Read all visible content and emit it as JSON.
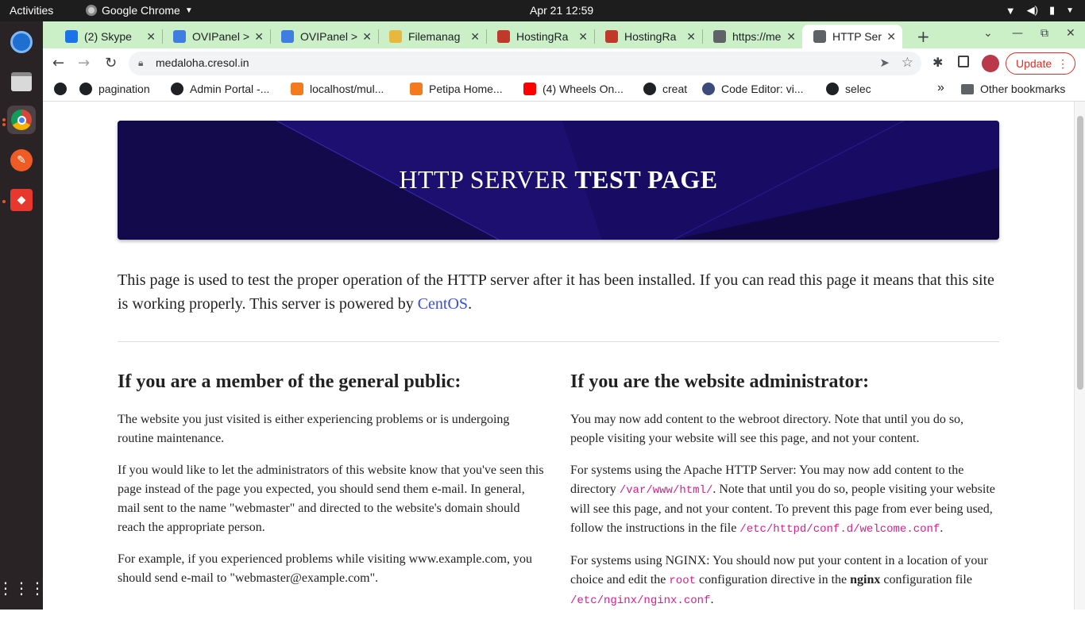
{
  "os": {
    "activities": "Activities",
    "app_name": "Google Chrome",
    "clock": "Apr 21  12:59"
  },
  "tabs": [
    {
      "title": "(2) Skype",
      "icon": "skype-icon",
      "color": "#1a73e8"
    },
    {
      "title": "OVIPanel >",
      "icon": "ovipanel-icon",
      "color": "#3d7ee0"
    },
    {
      "title": "OVIPanel >",
      "icon": "ovipanel-icon",
      "color": "#3d7ee0"
    },
    {
      "title": "Filemanag",
      "icon": "folder-icon",
      "color": "#e8b73e"
    },
    {
      "title": "HostingRa",
      "icon": "hostingraja-icon",
      "color": "#c0392b"
    },
    {
      "title": "HostingRa",
      "icon": "hostingraja-icon",
      "color": "#c0392b"
    },
    {
      "title": "https://me",
      "icon": "globe-icon",
      "color": "#5f6368"
    },
    {
      "title": "HTTP Serv",
      "icon": "globe-icon",
      "color": "#5f6368",
      "active": true
    }
  ],
  "toolbar": {
    "url": "medaloha.cresol.in",
    "update_label": "Update"
  },
  "bookmarks": [
    {
      "label": "",
      "icon": "globe-icon"
    },
    {
      "label": "pagination",
      "icon": "globe-icon"
    },
    {
      "label": "Admin Portal -...",
      "icon": "globe-icon"
    },
    {
      "label": "localhost/mul...",
      "icon": "xampp-icon"
    },
    {
      "label": "Petipa Home...",
      "icon": "xampp-icon"
    },
    {
      "label": "(4) Wheels On...",
      "icon": "youtube-icon"
    },
    {
      "label": "creat",
      "icon": "globe-icon"
    },
    {
      "label": "Code Editor: vi...",
      "icon": "p-icon"
    },
    {
      "label": "selec",
      "icon": "globe-icon"
    }
  ],
  "bookmarks_more": "»",
  "other_bookmarks": "Other bookmarks",
  "page": {
    "hero_light": "HTTP SERVER ",
    "hero_bold": "TEST PAGE",
    "intro_before": "This page is used to test the proper operation of the HTTP server after it has been installed. If you can read this page it means that this site is working properly. This server is powered by ",
    "intro_link": "CentOS",
    "intro_after": ".",
    "left": {
      "heading": "If you are a member of the general public:",
      "p1": "The website you just visited is either experiencing problems or is undergoing routine maintenance.",
      "p2": "If you would like to let the administrators of this website know that you've seen this page instead of the page you expected, you should send them e-mail. In general, mail sent to the name \"webmaster\" and directed to the website's domain should reach the appropriate person.",
      "p3": "For example, if you experienced problems while visiting www.example.com, you should send e-mail to \"webmaster@example.com\"."
    },
    "right": {
      "heading": "If you are the website administrator:",
      "p1": "You may now add content to the webroot directory. Note that until you do so, people visiting your website will see this page, and not your content.",
      "p2_a": "For systems using the Apache HTTP Server: You may now add content to the directory ",
      "p2_code1": "/var/www/html/",
      "p2_b": ". Note that until you do so, people visiting your website will see this page, and not your content. To prevent this page from ever being used, follow the instructions in the file ",
      "p2_code2": "/etc/httpd/conf.d/welcome.conf",
      "p2_c": ".",
      "p3_a": "For systems using NGINX: You should now put your content in a location of your choice and edit the ",
      "p3_code1": "root",
      "p3_b": " configuration directive in the ",
      "p3_bold": "nginx",
      "p3_c": " configuration file ",
      "p3_code2": "/etc/nginx/nginx.conf",
      "p3_d": "."
    }
  }
}
